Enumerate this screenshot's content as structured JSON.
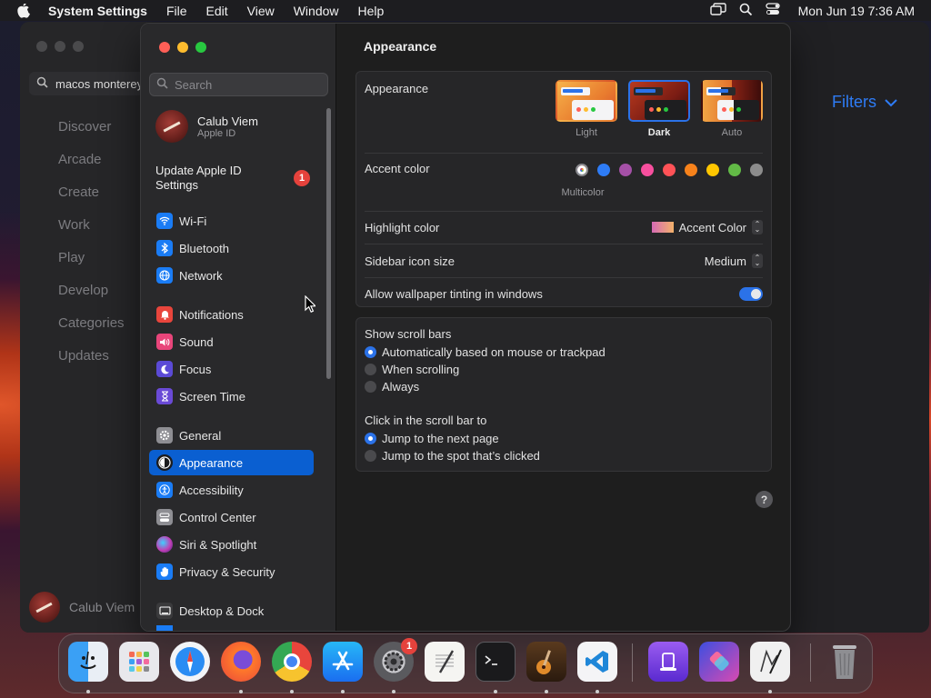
{
  "menubar": {
    "app_name": "System Settings",
    "menus": [
      "File",
      "Edit",
      "View",
      "Window",
      "Help"
    ],
    "clock": "Mon Jun 19  7:36 AM"
  },
  "background_window": {
    "search_value": "macos monterey",
    "nav": [
      "Discover",
      "Arcade",
      "Create",
      "Work",
      "Play",
      "Develop",
      "Categories",
      "Updates"
    ],
    "filters_label": "Filters",
    "user_name": "Calub Viem"
  },
  "sidebar": {
    "search_placeholder": "Search",
    "profile": {
      "name": "Calub Viem",
      "subtitle": "Apple ID"
    },
    "update": {
      "label": "Update Apple ID Settings",
      "badge": "1"
    },
    "items": [
      {
        "label": "Wi-Fi",
        "icon": "wifi-icon",
        "color": "#1a7cf5"
      },
      {
        "label": "Bluetooth",
        "icon": "bluetooth-icon",
        "color": "#1a7cf5"
      },
      {
        "label": "Network",
        "icon": "globe-icon",
        "color": "#1a7cf5"
      },
      {
        "label": "Notifications",
        "icon": "bell-icon",
        "color": "#e8453c"
      },
      {
        "label": "Sound",
        "icon": "speaker-icon",
        "color": "#e8457a"
      },
      {
        "label": "Focus",
        "icon": "moon-icon",
        "color": "#5b4ad6"
      },
      {
        "label": "Screen Time",
        "icon": "hourglass-icon",
        "color": "#6a4ad6"
      },
      {
        "label": "General",
        "icon": "gear-icon",
        "color": "#8e8e93"
      },
      {
        "label": "Appearance",
        "icon": "appearance-icon",
        "color": "#1c1c1e"
      },
      {
        "label": "Accessibility",
        "icon": "accessibility-icon",
        "color": "#1a7cf5"
      },
      {
        "label": "Control Center",
        "icon": "control-center-icon",
        "color": "#8e8e93"
      },
      {
        "label": "Siri & Spotlight",
        "icon": "siri-icon",
        "color": "#c13fb5"
      },
      {
        "label": "Privacy & Security",
        "icon": "hand-icon",
        "color": "#1a7cf5"
      },
      {
        "label": "Desktop & Dock",
        "icon": "desktop-icon",
        "color": "#3a3a3c"
      }
    ],
    "selected": "Appearance"
  },
  "main": {
    "title": "Appearance",
    "appearance": {
      "label": "Appearance",
      "options": [
        "Light",
        "Dark",
        "Auto"
      ],
      "selected": "Dark"
    },
    "accent": {
      "label": "Accent color",
      "colors": [
        "#multicolor",
        "#2e7cf6",
        "#a550a7",
        "#f74f9e",
        "#ff5257",
        "#f7821b",
        "#ffc600",
        "#62ba46",
        "#8c8c8c"
      ],
      "selected_name": "Multicolor"
    },
    "highlight": {
      "label": "Highlight color",
      "value": "Accent Color"
    },
    "sidebar_icon_size": {
      "label": "Sidebar icon size",
      "value": "Medium"
    },
    "wallpaper_tinting": {
      "label": "Allow wallpaper tinting in windows",
      "enabled": true
    },
    "scroll_bars": {
      "label": "Show scroll bars",
      "options": [
        "Automatically based on mouse or trackpad",
        "When scrolling",
        "Always"
      ],
      "selected": "Automatically based on mouse or trackpad"
    },
    "click_scroll": {
      "label": "Click in the scroll bar to",
      "options": [
        "Jump to the next page",
        "Jump to the spot that’s clicked"
      ],
      "selected": "Jump to the next page"
    },
    "help": "?"
  },
  "dock": {
    "apps": [
      "Finder",
      "Launchpad",
      "Safari",
      "Firefox",
      "Chrome",
      "App Store",
      "System Settings",
      "TextEdit",
      "Terminal",
      "GarageBand",
      "Visual Studio Code",
      "Apple Configurator",
      "Shortcuts",
      "Script Editor",
      "Trash"
    ],
    "system_settings_badge": "1"
  }
}
